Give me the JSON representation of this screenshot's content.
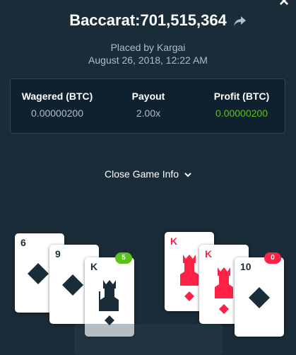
{
  "header": {
    "title": "Baccarat:701,515,364",
    "placed_by": "Placed by Kargai",
    "datetime": "August 26, 2018, 12:22 AM"
  },
  "stats": {
    "wagered": {
      "label": "Wagered (BTC)",
      "value": "0.00000200"
    },
    "payout": {
      "label": "Payout",
      "value": "2.00x"
    },
    "profit": {
      "label": "Profit (BTC)",
      "value": "0.00000200"
    }
  },
  "toggle": {
    "label": "Close Game Info"
  },
  "player_hand": {
    "badge": "5",
    "cards": [
      {
        "rank": "6",
        "suit": "spades"
      },
      {
        "rank": "9",
        "suit": "spades"
      },
      {
        "rank": "K",
        "suit": "spades"
      }
    ]
  },
  "banker_hand": {
    "badge": "0",
    "cards": [
      {
        "rank": "K",
        "suit": "diamonds"
      },
      {
        "rank": "K",
        "suit": "diamonds"
      },
      {
        "rank": "10",
        "suit": "spades"
      }
    ]
  },
  "colors": {
    "background": "#1a2c38",
    "panel": "#0f212e",
    "profit_green": "#5ac21a",
    "red": "#fe2247"
  }
}
